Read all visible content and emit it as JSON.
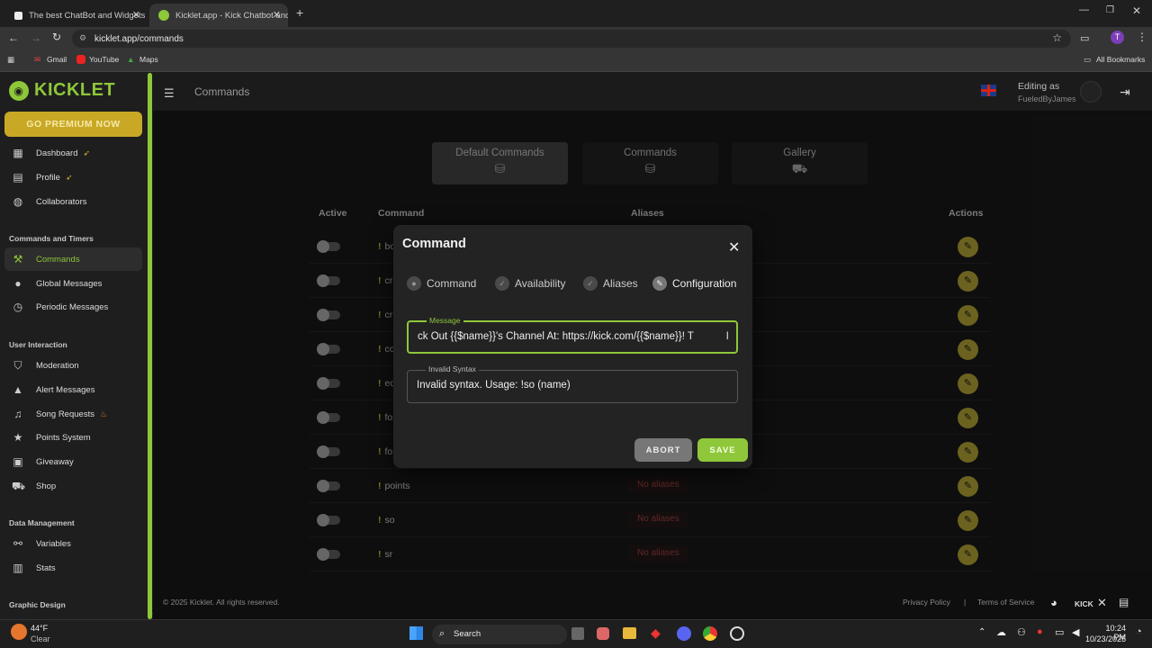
{
  "browser": {
    "tabs": [
      {
        "title": "The best ChatBot and Widgets"
      },
      {
        "title": "Kicklet.app - Kick Chatbot and"
      }
    ],
    "url": "kicklet.app/commands",
    "bookmarks": [
      "Gmail",
      "YouTube",
      "Maps"
    ],
    "all_bookmarks": "All Bookmarks",
    "profile_initial": "T"
  },
  "sidebar": {
    "logo": "KICKLET",
    "premium": "GO PREMIUM NOW",
    "items_top": [
      {
        "label": "Dashboard",
        "icon": "dashboard-icon"
      },
      {
        "label": "Profile",
        "icon": "profile-icon"
      },
      {
        "label": "Collaborators",
        "icon": "collaborators-icon"
      }
    ],
    "section1": "Commands and Timers",
    "items_cmd": [
      {
        "label": "Commands",
        "icon": "hammer-icon"
      },
      {
        "label": "Global Messages",
        "icon": "chat-icon"
      },
      {
        "label": "Periodic Messages",
        "icon": "clock-icon"
      }
    ],
    "section2": "User Interaction",
    "items_ui": [
      {
        "label": "Moderation",
        "icon": "shield-icon"
      },
      {
        "label": "Alert Messages",
        "icon": "alert-icon"
      },
      {
        "label": "Song Requests",
        "icon": "music-icon"
      },
      {
        "label": "Points System",
        "icon": "star-icon"
      },
      {
        "label": "Giveaway",
        "icon": "gift-icon"
      },
      {
        "label": "Shop",
        "icon": "cart-icon"
      }
    ],
    "section3": "Data Management",
    "items_dm": [
      {
        "label": "Variables",
        "icon": "variables-icon"
      },
      {
        "label": "Stats",
        "icon": "stats-icon"
      }
    ],
    "section4": "Graphic Design"
  },
  "header": {
    "page_title": "Commands",
    "editing_as": "Editing as",
    "user": "FueledByJames"
  },
  "categories": [
    {
      "label": "Default Commands"
    },
    {
      "label": "Commands"
    },
    {
      "label": "Gallery"
    }
  ],
  "table": {
    "headers": {
      "active": "Active",
      "command": "Command",
      "aliases": "Aliases",
      "actions": "Actions"
    },
    "rows": [
      {
        "name": "bo",
        "alias": ""
      },
      {
        "name": "cr",
        "alias": ""
      },
      {
        "name": "cr",
        "alias": ""
      },
      {
        "name": "co",
        "alias": ""
      },
      {
        "name": "ed",
        "alias": ""
      },
      {
        "name": "fo",
        "alias": ""
      },
      {
        "name": "fo",
        "alias": ""
      },
      {
        "name": "points",
        "alias": "No aliases"
      },
      {
        "name": "so",
        "alias": "No aliases"
      },
      {
        "name": "sr",
        "alias": "No aliases"
      }
    ]
  },
  "modal": {
    "title": "Command",
    "steps": [
      "Command",
      "Availability",
      "Aliases",
      "Configuration"
    ],
    "message_label": "Message",
    "message_value": "ck Out {{$name}}'s Channel At: https://kick.com/{{$name}}! T",
    "invalid_label": "Invalid Syntax",
    "invalid_value": "Invalid syntax. Usage: !so (name)",
    "abort": "ABORT",
    "save": "SAVE",
    "accent": "#8ec73a"
  },
  "footer": {
    "copyright": "© 2025 Kicklet. All rights reserved.",
    "privacy": "Privacy Policy",
    "separator": "|",
    "terms": "Terms of Service",
    "kick": "KICK"
  },
  "taskbar": {
    "temp": "44°F",
    "weather": "Clear",
    "search": "Search",
    "time": "10:24 PM",
    "date": "10/23/2025"
  }
}
